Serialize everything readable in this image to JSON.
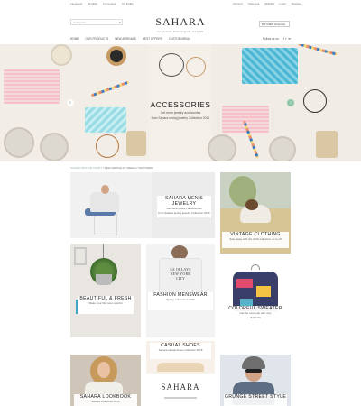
{
  "topbar": {
    "language_label": "Language:",
    "language_value": "English",
    "currency_label": "Currencies:",
    "currency_value": "US Dollar",
    "links": [
      "Account",
      "Checkout",
      "Wishlist",
      "Login",
      "Register"
    ]
  },
  "header": {
    "search_placeholder": "Categories",
    "logo": "SAHARA",
    "tagline": "FASHION BOUTIQUE STORE",
    "cart_label": "MY CART (0 items)"
  },
  "nav": {
    "items": [
      "HOME",
      "OUR PRODUCTS",
      "NEW ARRIVALS",
      "BEST OFFERS",
      "CUSTOM MENU"
    ],
    "follow_label": "Follow us on",
    "social_icons": [
      "f",
      "t",
      "✉"
    ]
  },
  "hero": {
    "title": "ACCESSORIES",
    "subtitle_line1": "Get more jewelry accessories",
    "subtitle_line2": "from Sahara spring jewelry Collection 2016",
    "prev_icon": "‹",
    "next_icon": "›"
  },
  "breadcrumb": {
    "items": [
      "SAHARA ROUND CHART",
      "NEW ARRIVALS",
      "WEEKLY FEATURED"
    ],
    "separator": "/"
  },
  "tiles": {
    "mens": {
      "title": "SAHARA MEN'S JEWELRY",
      "sub1": "Get more jewelry accessories",
      "sub2": "from Sahara spring jewelry Collection 2016"
    },
    "vintage": {
      "title": "VINTAGE CLOTHING",
      "sub1": "Sale away with the 2016 collection up to off"
    },
    "beautiful": {
      "title": "BEAUTIFUL & FRESH",
      "sub1": "Make your life more colorful"
    },
    "menswear": {
      "title": "FASHION MENSWEAR",
      "sub1": "Spring Collections 2016",
      "print": "SA ORLAYS NEW YORK CITY"
    },
    "sweater": {
      "title": "COLORFUL SWEATER",
      "sub1": "Get the new look with only",
      "sub2": "$199.00"
    },
    "casual": {
      "title": "CASUAL SHOES",
      "sub1": "Sahara casual shoes collection 2016"
    },
    "lookbook": {
      "title": "SAHARA LOOKBOOK",
      "sub1": "Sahara Collection 2016"
    },
    "logo_tile": {
      "text": "SAHARA"
    },
    "grunge": {
      "title": "GRUNGE STREET STYLE"
    }
  }
}
